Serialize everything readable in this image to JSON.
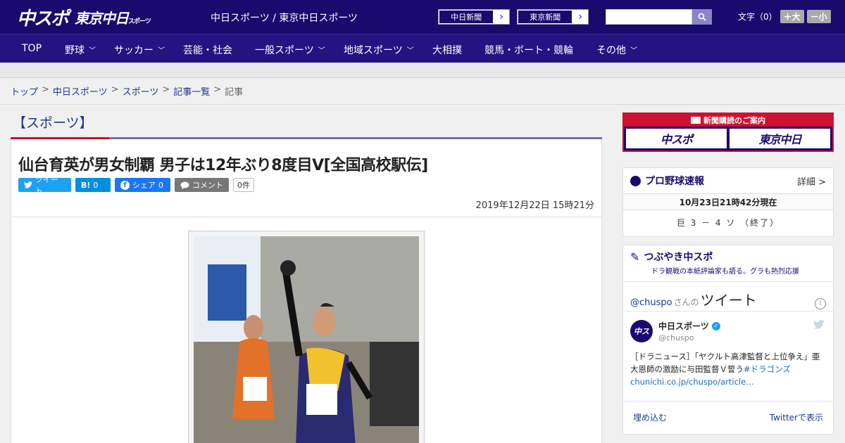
{
  "header": {
    "logo_main": "中スポ",
    "logo_sub": "東京中日",
    "logo_sub_small": "スポーツ",
    "title": "中日スポーツ / 東京中日スポーツ",
    "paper_links": [
      "中日新聞",
      "東京新聞"
    ],
    "fontsize_label": "文字（0）",
    "fontsize_up": "＋大",
    "fontsize_down": "－小"
  },
  "nav": {
    "items": [
      {
        "label": "TOP",
        "dropdown": false
      },
      {
        "label": "野球",
        "dropdown": true
      },
      {
        "label": "サッカー",
        "dropdown": true
      },
      {
        "label": "芸能・社会",
        "dropdown": false
      },
      {
        "label": "一般スポーツ",
        "dropdown": true
      },
      {
        "label": "地域スポーツ",
        "dropdown": true
      },
      {
        "label": "大相撲",
        "dropdown": false
      },
      {
        "label": "競馬・ボート・競輪",
        "dropdown": false
      },
      {
        "label": "その他",
        "dropdown": true
      }
    ]
  },
  "breadcrumb": {
    "items": [
      "トップ",
      "中日スポーツ",
      "スポーツ",
      "記事一覧"
    ],
    "current": "記事",
    "separator": ">"
  },
  "article": {
    "section": "【スポーツ】",
    "headline": "仙台育英が男女制覇 男子は12年ぶり8度目V[全国高校駅伝]",
    "share": {
      "tweet": "ツイート",
      "hatena": "B!",
      "hatena_count": "0",
      "facebook": "シェア",
      "facebook_count": "0",
      "comment": "コメント",
      "comment_count": "0件"
    },
    "date": "2019年12月22日 15時21分"
  },
  "sidebar": {
    "promo": {
      "title": "新聞購読のご案内",
      "logos": [
        "中スポ",
        "東京中日"
      ]
    },
    "baseball": {
      "title": "プロ野球速報",
      "more": "詳細 >",
      "as_of": "10月23日21時42分現在",
      "score": "巨 3 － 4 ソ （終了）"
    },
    "tweets": {
      "title": "つぶやき中スポ",
      "subtitle": "ドラ観戦の本紙評論家も語る。グラも熱烈応援",
      "handle": "@chuspo",
      "handle_suffix": "さんの",
      "big": "ツイート",
      "tweet": {
        "name": "中日スポーツ",
        "handle": "@chuspo",
        "text": "［ドラニュース］「ヤクルト高津監督と上位争え」亜大恩師の激励に与田監督Ｖ誓う",
        "tag": "#ドラゴンズ",
        "link": "chunichi.co.jp/chuspo/article…"
      },
      "embed": "埋め込む",
      "view_on": "Twitterで表示"
    }
  }
}
